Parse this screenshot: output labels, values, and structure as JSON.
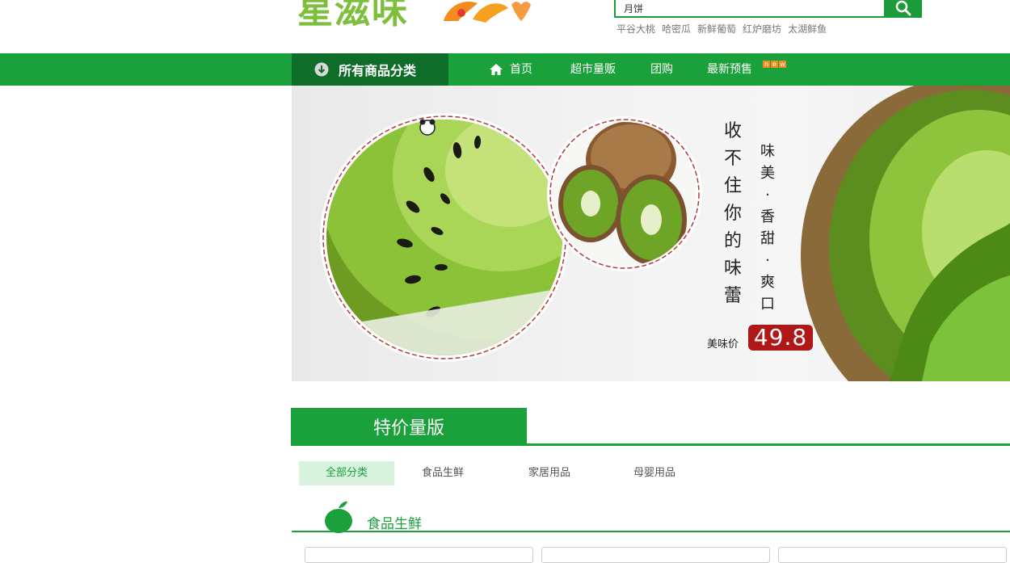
{
  "header": {
    "logo_text": "星滋味",
    "search": {
      "value": "月饼",
      "placeholder": ""
    },
    "hot_keywords": [
      "平谷大桃",
      "哈密瓜",
      "新鲜葡萄",
      "红炉磨坊",
      "太湖鲜鱼"
    ]
  },
  "nav": {
    "all_categories": "所有商品分类",
    "items": [
      {
        "label": "首页",
        "icon": "home-icon"
      },
      {
        "label": "超市量贩"
      },
      {
        "label": "团购"
      },
      {
        "label": "最新预售",
        "badge": [
          "n",
          "e",
          "w"
        ]
      }
    ]
  },
  "banner": {
    "headline": "收不住你的味蕾",
    "tagline": "味美·香甜·爽口",
    "price_label": "美味价",
    "price": "49.8"
  },
  "section": {
    "title": "特价量版",
    "filters": [
      "全部分类",
      "食品生鲜",
      "家居用品",
      "母婴用品"
    ],
    "active_filter": 0,
    "subcategory": {
      "title": "食品生鲜",
      "icon": "apple-icon"
    }
  },
  "colors": {
    "brand_green": "#1ba13c",
    "dark_green": "#0f6d2a",
    "price_red": "#b01818",
    "logo_green": "#7dbf3a"
  }
}
